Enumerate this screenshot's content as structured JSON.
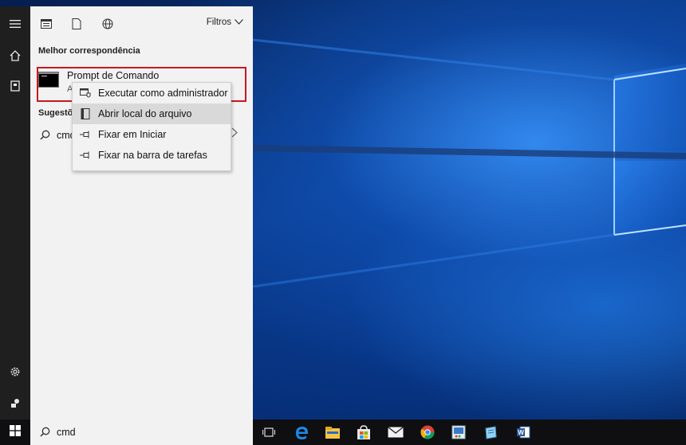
{
  "panel": {
    "filters_label": "Filtros",
    "best_match_heading": "Melhor correspondência",
    "best_match": {
      "title": "Prompt de Comando",
      "subtitle": "A"
    },
    "suggestions_heading": "Sugestõe",
    "suggestion_text": "cmd"
  },
  "context_menu": {
    "items": [
      {
        "label": "Executar como administrador",
        "icon": "shield-window-icon"
      },
      {
        "label": "Abrir local do arquivo",
        "icon": "open-folder-icon"
      },
      {
        "label": "Fixar em Iniciar",
        "icon": "pin-icon"
      },
      {
        "label": "Fixar na barra de tarefas",
        "icon": "pin-icon"
      }
    ],
    "highlighted_index": 1
  },
  "taskbar": {
    "search_value": "cmd",
    "apps": [
      "task-view-icon",
      "edge-icon",
      "file-explorer-icon",
      "store-icon",
      "mail-icon",
      "chrome-icon",
      "paint-icon",
      "notepad-icon",
      "word-icon"
    ]
  },
  "colors": {
    "best_match_border": "#c8181f",
    "accent": "#0078d7"
  }
}
